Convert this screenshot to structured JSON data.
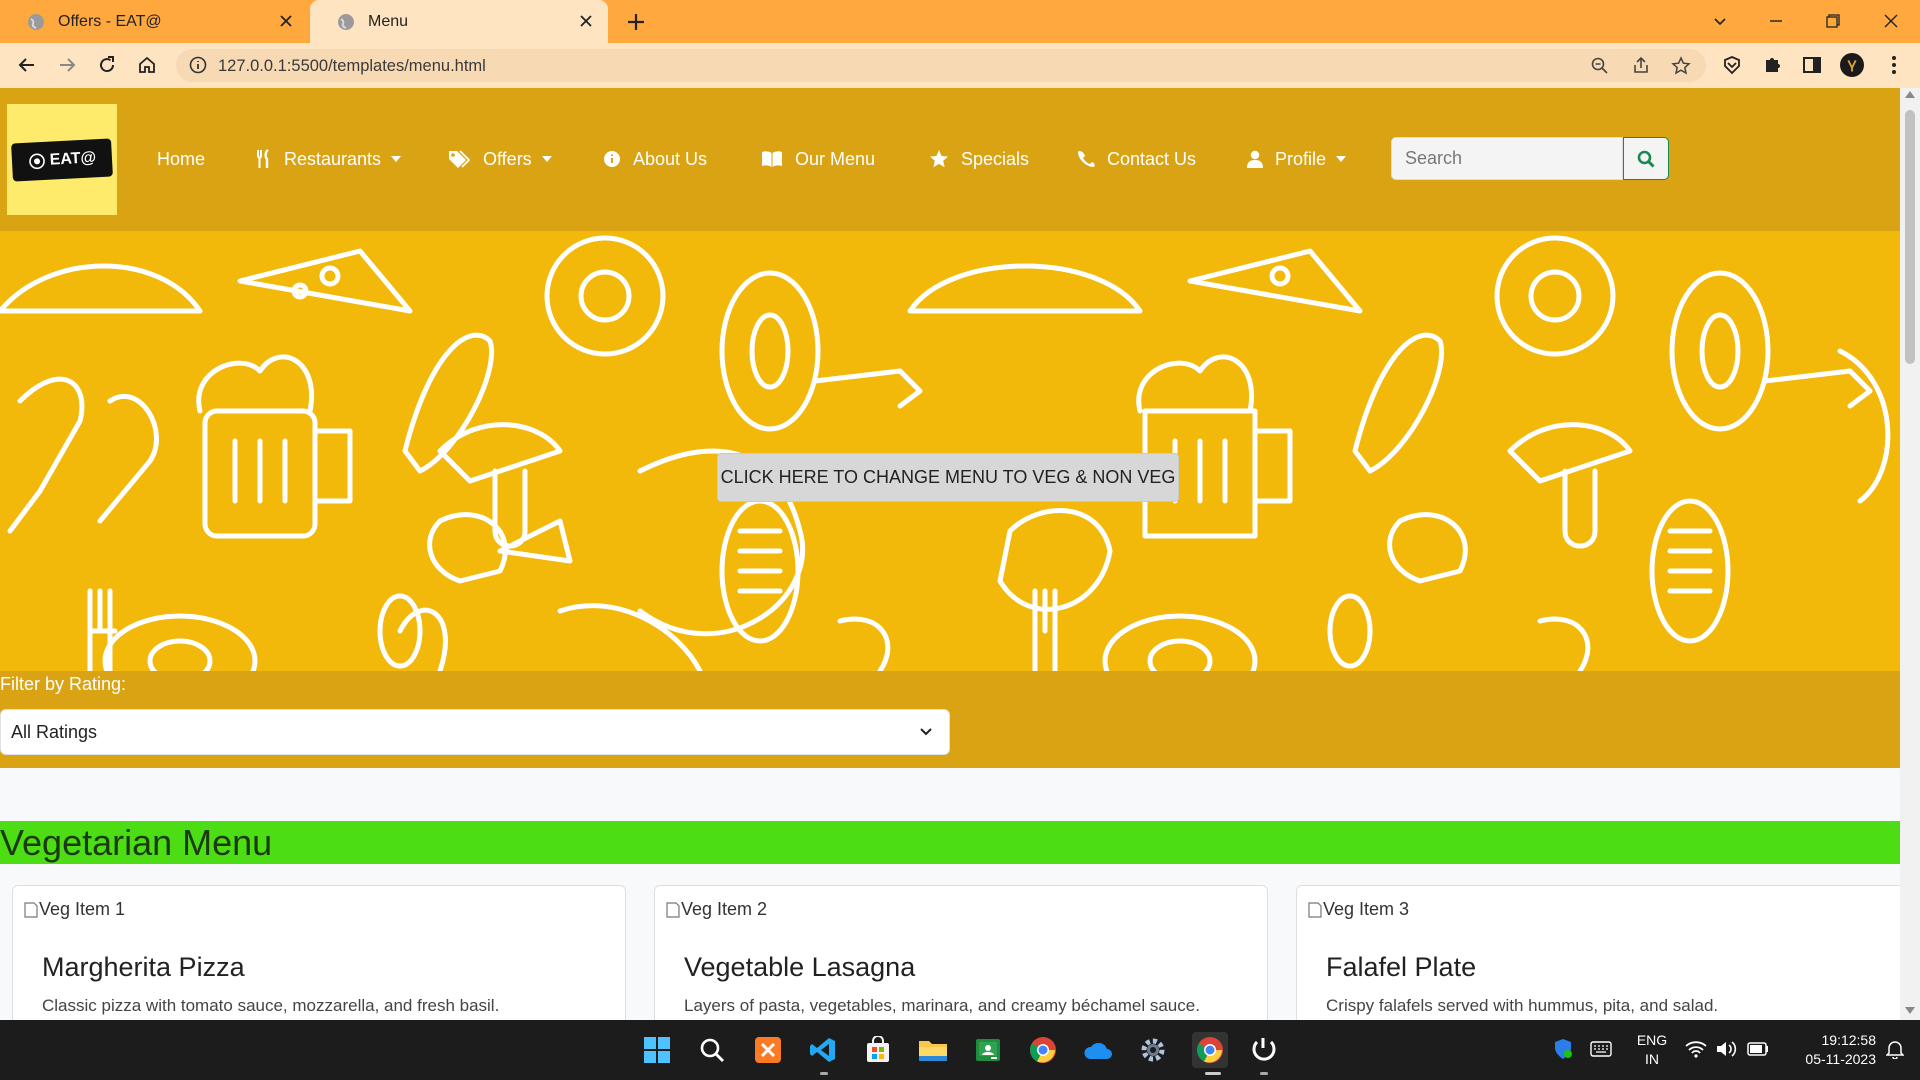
{
  "browser": {
    "tabs": [
      {
        "title": "Offers - EAT@",
        "active": false
      },
      {
        "title": "Menu",
        "active": true
      }
    ],
    "url": "127.0.0.1:5500/templates/menu.html"
  },
  "navbar": {
    "logo_text": "EAT@",
    "items": [
      {
        "label": "Home",
        "icon": "none"
      },
      {
        "label": "Restaurants",
        "icon": "utensils-icon",
        "dropdown": true
      },
      {
        "label": "Offers",
        "icon": "tags-icon",
        "dropdown": true
      },
      {
        "label": "About Us",
        "icon": "info-circle-icon"
      },
      {
        "label": "Our Menu",
        "icon": "book-open-icon"
      },
      {
        "label": "Specials",
        "icon": "star-icon"
      },
      {
        "label": "Contact Us",
        "icon": "phone-icon"
      },
      {
        "label": "Profile",
        "icon": "user-icon",
        "dropdown": true
      }
    ],
    "search_placeholder": "Search"
  },
  "hero": {
    "button_label": "CLICK HERE TO CHANGE MENU TO VEG & NON VEG"
  },
  "filter": {
    "label": "Filter by Rating:",
    "selected": "All Ratings"
  },
  "menu": {
    "heading": "Vegetarian Menu",
    "items": [
      {
        "img_alt": "Veg Item 1",
        "name": "Margherita Pizza",
        "description": "Classic pizza with tomato sauce, mozzarella, and fresh basil."
      },
      {
        "img_alt": "Veg Item 2",
        "name": "Vegetable Lasagna",
        "description": "Layers of pasta, vegetables, marinara, and creamy béchamel sauce."
      },
      {
        "img_alt": "Veg Item 3",
        "name": "Falafel Plate",
        "description": "Crispy falafels served with hummus, pita, and salad."
      }
    ]
  },
  "taskbar": {
    "lang_line1": "ENG",
    "lang_line2": "IN",
    "time": "19:12:58",
    "date": "05-11-2023"
  },
  "colors": {
    "tabbar": "#FFA83E",
    "navbar": "#DAA313",
    "hero": "#F2B90A",
    "menu_heading": "#4CDD15"
  }
}
